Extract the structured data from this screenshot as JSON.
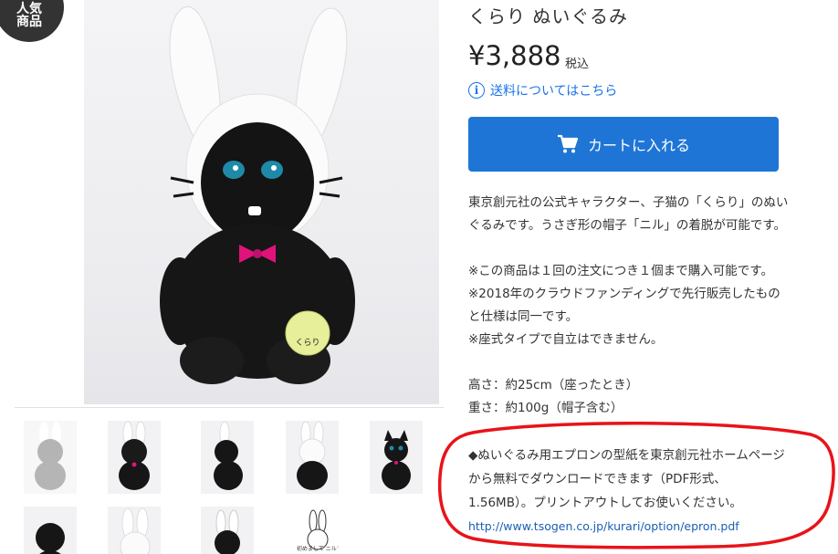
{
  "badge": {
    "line1": "人気",
    "line2": "商品"
  },
  "product": {
    "title": "くらり ぬいぐるみ",
    "price": "¥3,888",
    "tax_label": "税込",
    "shipping_link": "送料についてはこちら",
    "cart_button": "カートに入れる"
  },
  "description": {
    "lines": [
      "東京創元社の公式キャラクター、子猫の「くらり」のぬい",
      "ぐるみです。うさぎ形の帽子「ニル」の着脱が可能です。"
    ],
    "notes": [
      "※この商品は１回の注文につき１個まで購入可能です。",
      "※2018年のクラウドファンディングで先行販売したもの",
      "と仕様は同一です。",
      "※座式タイプで自立はできません。"
    ],
    "specs": [
      "高さ：約25cm（座ったとき）",
      "重さ：約100g（帽子含む）"
    ]
  },
  "apron_note": {
    "lines": [
      "◆ぬいぐるみ用エプロンの型紙を東京創元社ホームページ",
      "から無料でダウンロードできます（PDF形式、",
      "1.56MB）。プリントアウトしてお使いください。"
    ],
    "link": "http://www.tsogen.co.jp/kurari/option/epron.pdf"
  },
  "thumbnail_tag": "くらり",
  "thumbnail_caption": "初めまして ニルです",
  "colors": {
    "accent": "#1f75d6",
    "link": "#1a73e8",
    "annotation": "#e8131a",
    "bowtie": "#e0137a"
  },
  "icons": {
    "info": "info-icon",
    "cart": "cart-icon"
  }
}
